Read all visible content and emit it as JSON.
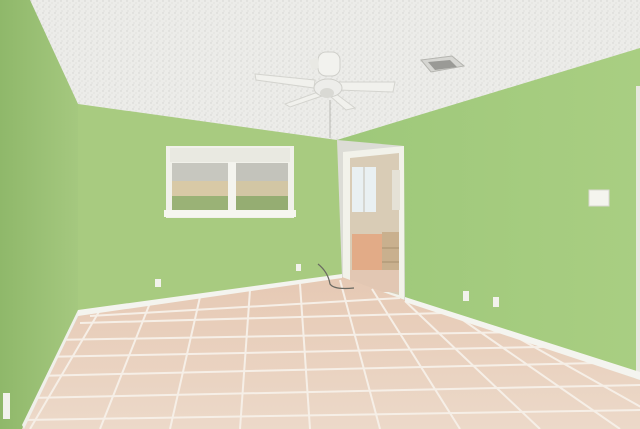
{
  "scene": {
    "type": "photo",
    "subject": "empty-room-interior",
    "colors": {
      "wall": "#a7cc7e",
      "wall_shadow": "#8fb86a",
      "ceiling": "#ececea",
      "floor_tile": "#e9d6c6",
      "floor_tile_warm": "#e3bfa8",
      "grout": "#f3eee8",
      "baseboard": "#f4f4ef",
      "window_frame": "#f1f1ea",
      "door_frame": "#f2f2ea"
    },
    "objects": [
      "ceiling-fan-icon",
      "ceiling-vent-icon",
      "window-icon",
      "doorway-icon",
      "light-switch-icon",
      "power-outlet-icon",
      "tile-floor-icon"
    ]
  }
}
